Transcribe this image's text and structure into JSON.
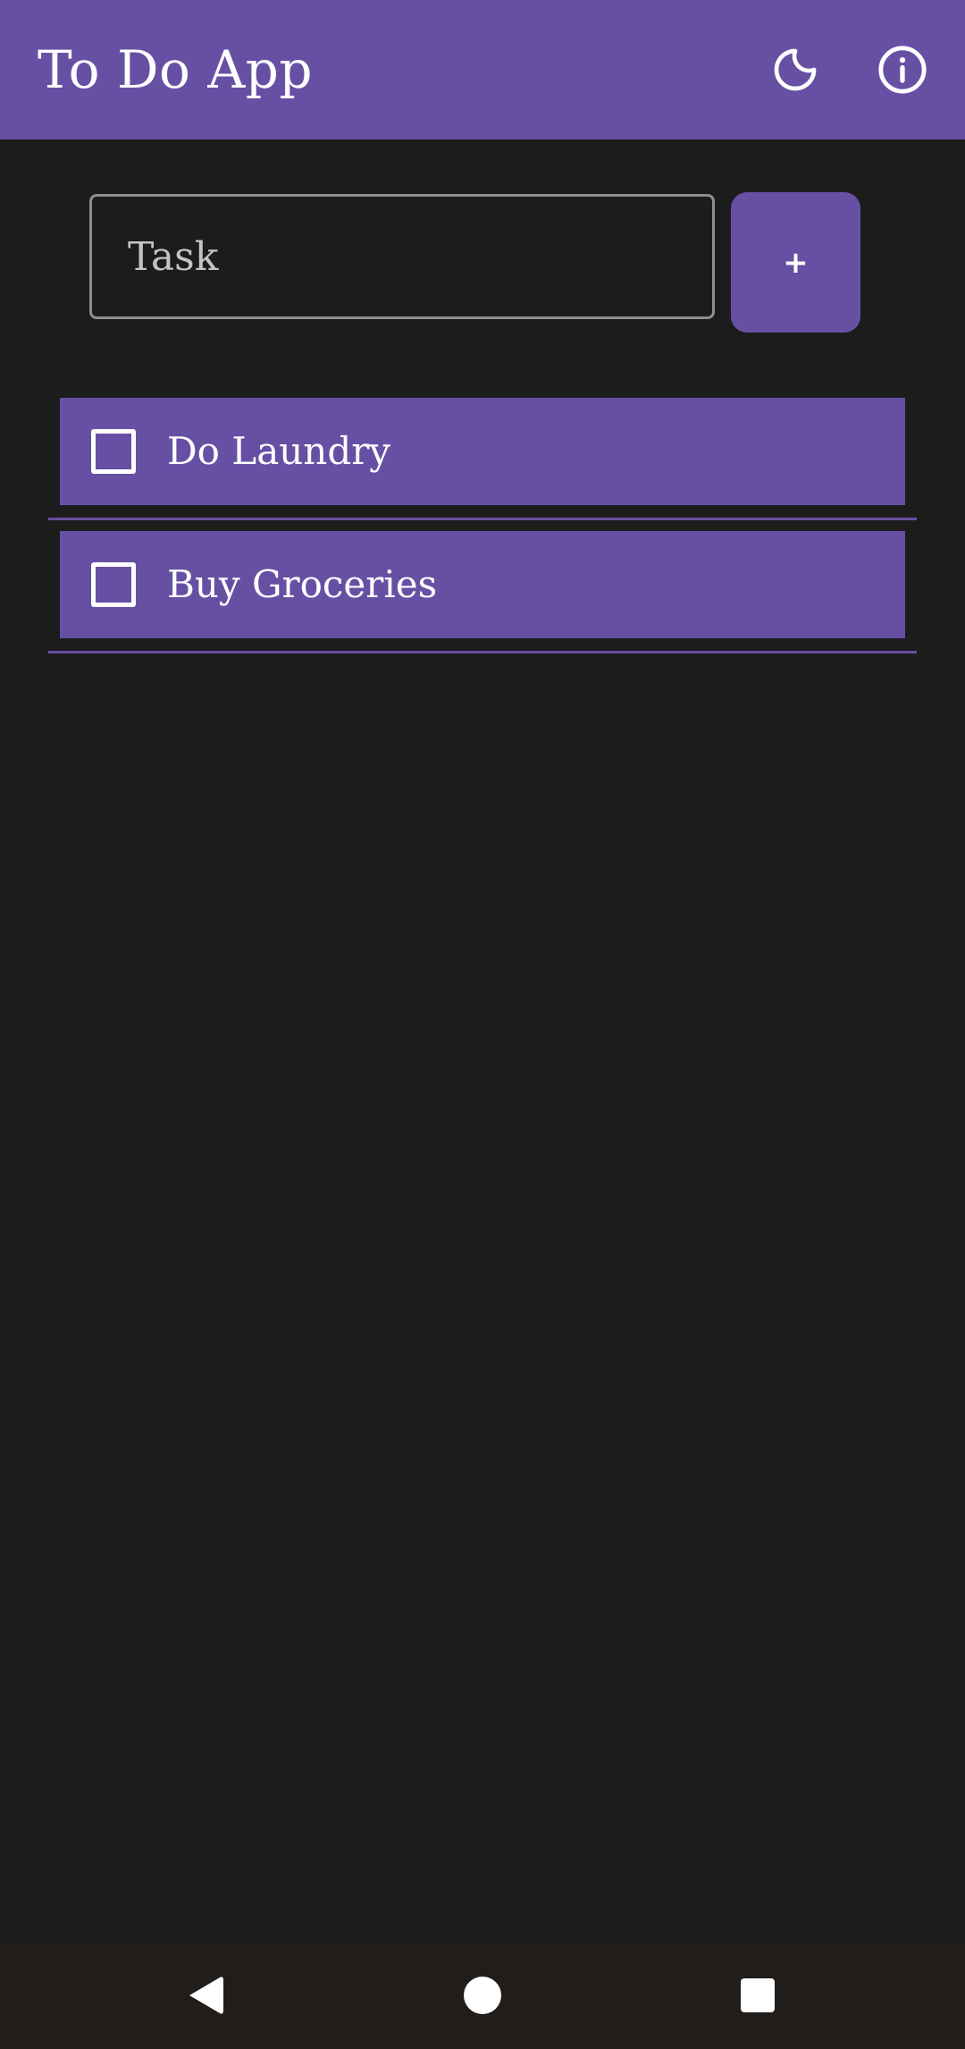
{
  "app_bar": {
    "title": "To Do App",
    "theme_icon": "moon-icon",
    "info_icon": "info-icon",
    "background": "#6750a4"
  },
  "task_input": {
    "placeholder": "Task",
    "value": ""
  },
  "add_button": {
    "label": "+"
  },
  "tasks": [
    {
      "label": "Do Laundry",
      "checked": false
    },
    {
      "label": "Buy Groceries",
      "checked": false
    }
  ],
  "nav_bar": {
    "back_icon": "back-triangle-icon",
    "home_icon": "home-circle-icon",
    "recents_icon": "recents-square-icon"
  },
  "colors": {
    "accent": "#6750a4",
    "background": "#1c1c1c",
    "nav_background": "#211d1b",
    "text": "#ffffff"
  }
}
